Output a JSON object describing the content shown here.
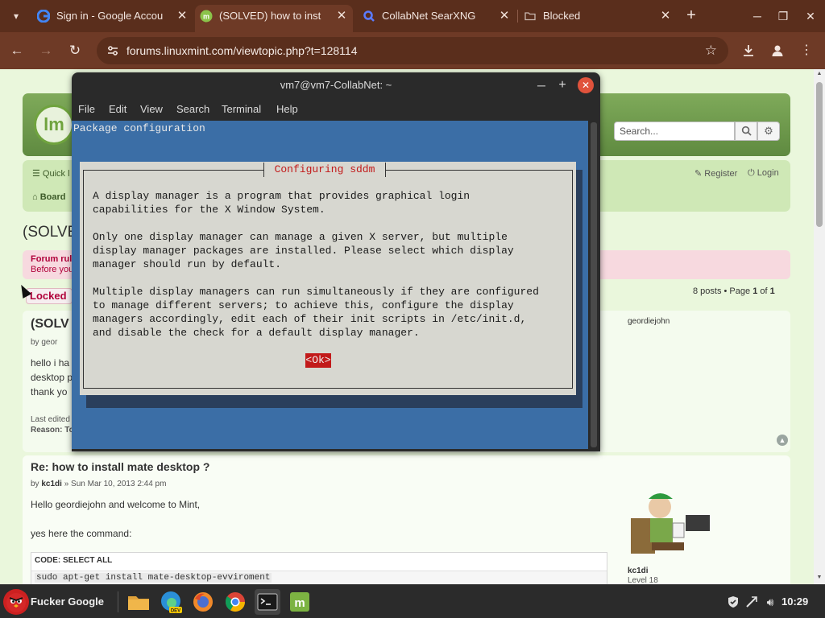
{
  "browser": {
    "tabs": [
      {
        "title": "Sign in - Google Accou",
        "active": false
      },
      {
        "title": "(SOLVED) how to inst",
        "active": true
      },
      {
        "title": "CollabNet SearXNG",
        "active": false
      },
      {
        "title": "Blocked",
        "active": false
      }
    ],
    "url": "forums.linuxmint.com/viewtopic.php?t=128114"
  },
  "forum": {
    "search_placeholder": "Search...",
    "quick_links": "Quick l",
    "board_index": "Board",
    "register": "Register",
    "login": "Login",
    "topic_title": "(SOLVE",
    "rules_title": "Forum rul",
    "rules_text": "Before you",
    "locked_label": "Locked",
    "pagination": {
      "prefix": "8 posts • Page ",
      "page": "1",
      "of": " of ",
      "total": "1"
    },
    "post1": {
      "title": "(SOLV",
      "by": "by geor",
      "author": "geordiejohn",
      "lines": [
        "hello i ha",
        "desktop p",
        "thank yo"
      ],
      "edited": "Last edited",
      "reason": "Reason: To"
    },
    "post2": {
      "title": "Re: how to install mate desktop ?",
      "by_prefix": "by ",
      "by_user": "kc1di",
      "by_date": " » Sun Mar 10, 2013 2:44 pm",
      "line1": "Hello geordiejohn and welcome to Mint,",
      "line2": "yes here the command:",
      "code_header": "CODE: SELECT ALL",
      "code": "sudo apt-get install mate-desktop-evviroment",
      "author": "kc1di",
      "level": "Level 18"
    }
  },
  "terminal": {
    "title": "vm7@vm7-CollabNet: ~",
    "menu": [
      "File",
      "Edit",
      "View",
      "Search",
      "Terminal",
      "Help"
    ],
    "screen_heading": "Package configuration",
    "dialog": {
      "title": "Configuring sddm",
      "para1": "A display manager is a program that provides graphical login\ncapabilities for the X Window System.",
      "para2": "Only one display manager can manage a given X server, but multiple\ndisplay manager packages are installed. Please select which display\nmanager should run by default.",
      "para3": "Multiple display managers can run simultaneously if they are configured\nto manage different servers; to achieve this, configure the display\nmanagers accordingly, edit each of their init scripts in /etc/init.d,\nand disable the check for a default display manager.",
      "ok_label": "<Ok>"
    }
  },
  "taskbar": {
    "start_label": "Fucker Google",
    "clock": "10:29"
  }
}
